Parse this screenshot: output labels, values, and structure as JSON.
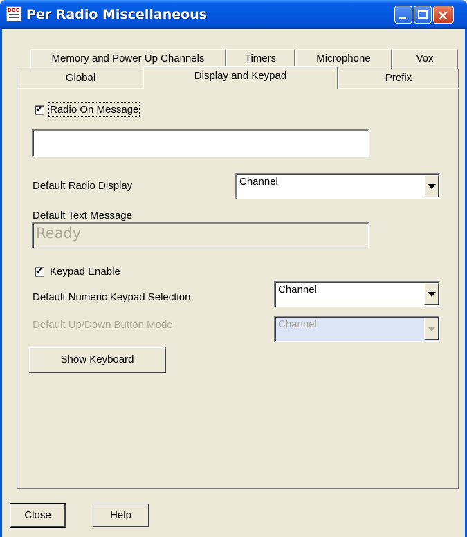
{
  "window": {
    "title": "Per Radio Miscellaneous"
  },
  "tabs_row1": [
    "Memory and Power Up Channels",
    "Timers",
    "Microphone",
    "Vox"
  ],
  "tabs_row2": [
    "Global",
    "Display and Keypad",
    "Prefix"
  ],
  "active_tab": "Display and Keypad",
  "radio_on_message": {
    "label": "Radio On Message",
    "checked": true,
    "value": ""
  },
  "default_radio_display": {
    "label": "Default Radio Display",
    "value": "Channel"
  },
  "default_text_message": {
    "label": "Default Text Message",
    "value": "Ready"
  },
  "keypad_enable": {
    "label": "Keypad Enable",
    "checked": true
  },
  "default_numeric_keypad": {
    "label": "Default Numeric Keypad Selection",
    "value": "Channel"
  },
  "default_updown_mode": {
    "label": "Default Up/Down Button Mode",
    "value": "Channel",
    "disabled": true
  },
  "buttons": {
    "show_keyboard": "Show Keyboard",
    "close": "Close",
    "help": "Help"
  },
  "check_glyph": "✔",
  "icons": {
    "window_icon": "doc-icon",
    "minimize": "minimize-icon",
    "maximize": "maximize-icon",
    "close": "close-icon"
  },
  "colors": {
    "titlebar": "#0458e0",
    "face": "#ece9d8",
    "disabled_select": "#dce6f7"
  }
}
